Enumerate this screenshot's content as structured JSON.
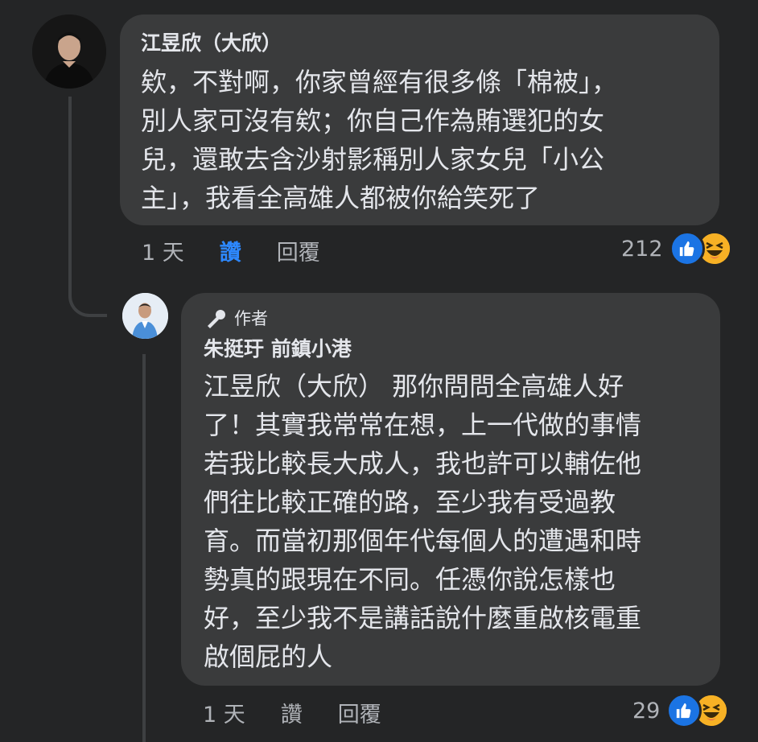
{
  "comment": {
    "author": "江昱欣（大欣）",
    "lines": [
      "欸，不對啊，你家曾經有很多條「棉被」，",
      "別人家可沒有欸；你自己作為賄選犯的女",
      "兒，還敢去含沙射影稱別人家女兒「小公",
      "主」，我看全高雄人都被你給笑死了"
    ],
    "time": "1 天",
    "like_label": "讚",
    "reply_label": "回覆",
    "reaction_count": "212"
  },
  "reply": {
    "badge_label": "作者",
    "author": "朱挺玗 前鎮小港",
    "lines": [
      "江昱欣（大欣） 那你問問全高雄人好",
      "了！其實我常常在想，上一代做的事情",
      "若我比較長大成人，我也許可以輔佐他",
      "們往比較正確的路，至少我有受過教",
      "育。而當初那個年代每個人的遭遇和時",
      "勢真的跟現在不同。任憑你說怎樣也",
      "好，至少我不是講話說什麼重啟核電重",
      "啟個屁的人"
    ],
    "time": "1 天",
    "like_label": "讚",
    "reply_label": "回覆",
    "reaction_count": "29"
  },
  "icons": [
    "like-icon",
    "haha-icon",
    "microphone-icon"
  ],
  "colors": {
    "background": "#242526",
    "bubble": "#3a3b3c",
    "liked": "#2d88ff",
    "like_icon": "#1b74e4",
    "haha_icon": "#f7b125"
  }
}
